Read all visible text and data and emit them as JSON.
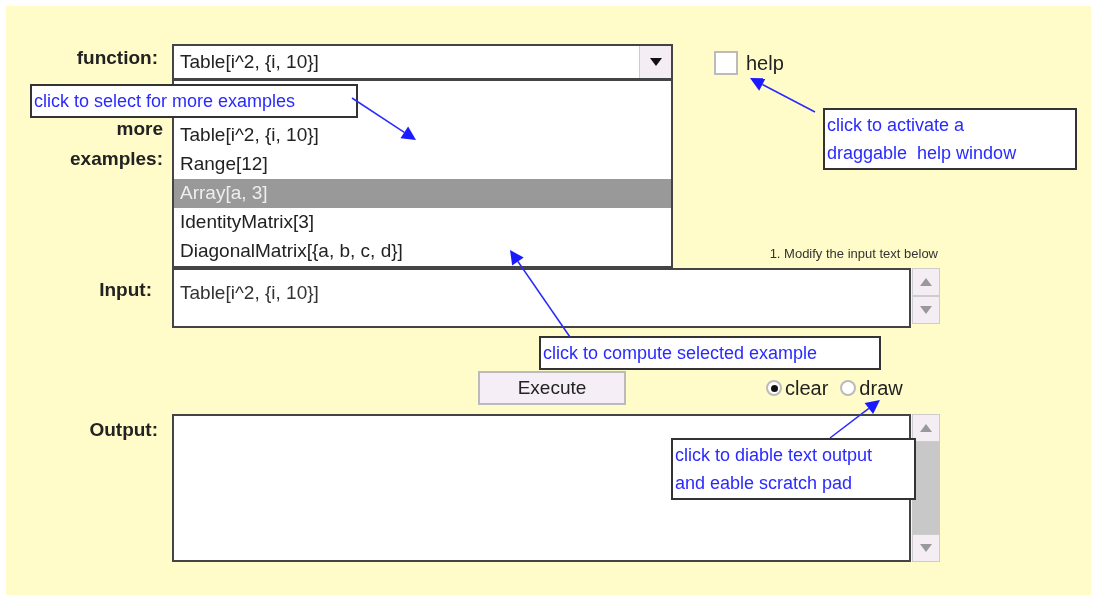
{
  "function": {
    "label": "function:",
    "value": "Table[i^2, {i, 10}]"
  },
  "help": {
    "label": "help",
    "checked": false
  },
  "examples": {
    "label": "more examples:",
    "options": [
      {
        "label": "Table[i^2, {i, 10}]",
        "selected": false
      },
      {
        "label": "Range[12]",
        "selected": false
      },
      {
        "label": "Array[a, 3]",
        "selected": true
      },
      {
        "label": "IdentityMatrix[3]",
        "selected": false
      },
      {
        "label": "DiagonalMatrix[{a, b, c, d}]",
        "selected": false
      }
    ]
  },
  "input": {
    "label": "Input:",
    "hint": "1. Modify the input text below",
    "value": "Table[i^2, {i, 10}]"
  },
  "execute": "Execute",
  "mode": [
    {
      "label": "clear",
      "selected": true
    },
    {
      "label": "draw",
      "selected": false
    }
  ],
  "output": {
    "label": "Output:"
  },
  "callouts": [
    {
      "lines": [
        "click to select for more examples"
      ]
    },
    {
      "lines": [
        "click to activate a",
        "draggable  help window"
      ]
    },
    {
      "lines": [
        "click to compute selected example"
      ]
    },
    {
      "lines": [
        "click to diable text output",
        "and eable scratch pad"
      ]
    }
  ]
}
